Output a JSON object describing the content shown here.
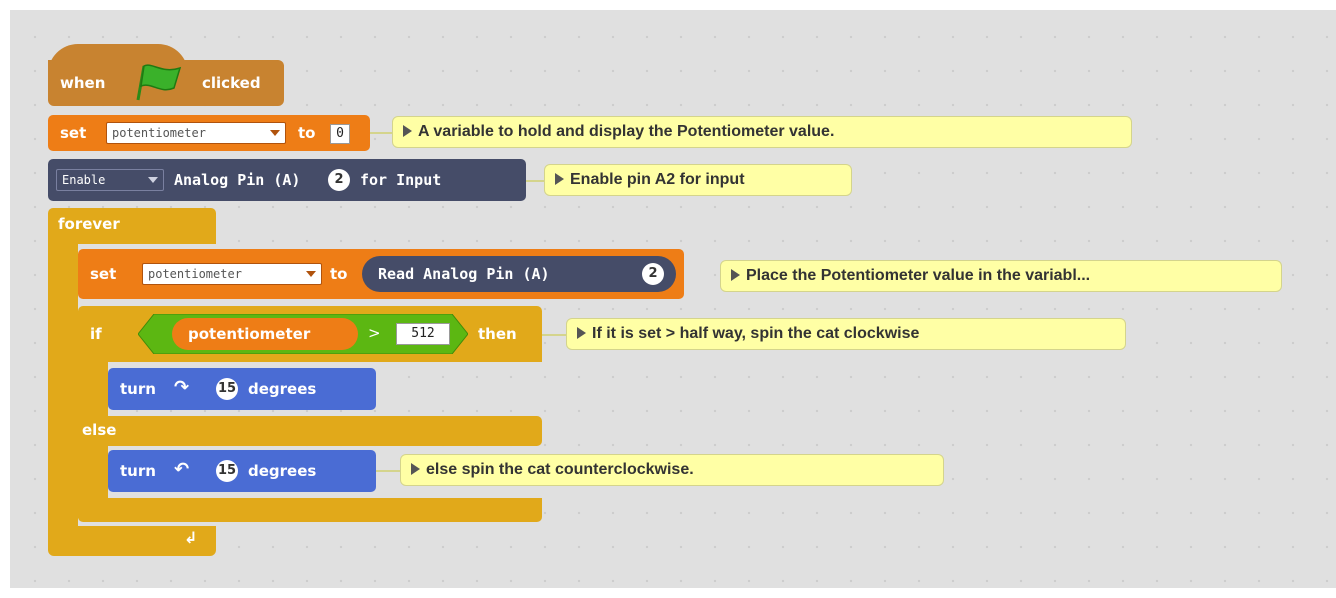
{
  "script": {
    "hat": {
      "when": "when",
      "clicked": "clicked",
      "flag_icon": "green-flag-icon"
    },
    "set1": {
      "set": "set",
      "var": "potentiometer",
      "to": "to",
      "value": "0"
    },
    "enable": {
      "mode": "Enable",
      "label": "Analog Pin (A)",
      "pin": "2",
      "suffix": "for Input"
    },
    "forever": {
      "label": "forever"
    },
    "set2": {
      "set": "set",
      "var": "potentiometer",
      "to": "to",
      "read": "Read Analog Pin (A)",
      "pin": "2"
    },
    "if": {
      "if": "if",
      "var": "potentiometer",
      "op": ">",
      "value": "512",
      "then": "then"
    },
    "turn_cw": {
      "turn": "turn",
      "degrees_value": "15",
      "degrees": "degrees",
      "icon": "rotate-clockwise-icon"
    },
    "else": {
      "label": "else"
    },
    "turn_ccw": {
      "turn": "turn",
      "degrees_value": "15",
      "degrees": "degrees",
      "icon": "rotate-counterclockwise-icon"
    }
  },
  "comments": {
    "c1": "A variable to hold and display the Potentiometer value.",
    "c2": "Enable pin A2 for input",
    "c3": "Place the Potentiometer value in the variabl...",
    "c4": "If it is set > half way, spin the cat clockwise",
    "c5": "else spin the cat counterclockwise."
  },
  "colors": {
    "events": "#c88330",
    "variables": "#ee7d16",
    "arduino": "#454c68",
    "control": "#e1a91a",
    "motion": "#4a6cd4",
    "operators": "#5cb712",
    "comment": "#ffffa5"
  }
}
